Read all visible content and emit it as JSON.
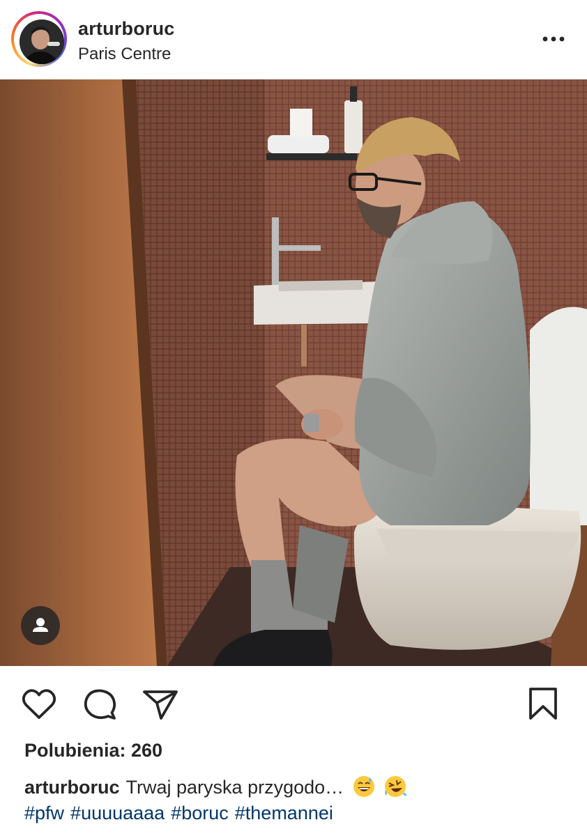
{
  "post": {
    "username": "arturboruc",
    "location": "Paris Centre",
    "likes_text": "Polubienia: 260",
    "caption": {
      "username": "arturboruc",
      "text": "Trwaj paryska przygodo…",
      "emojis": [
        "grinning-sweat-emoji",
        "rofl-emoji"
      ]
    },
    "hashtags": [
      "#pfw",
      "#uuuuaaaa",
      "#boruc",
      "#themannei"
    ]
  },
  "icons": {
    "more": "more-dots-icon",
    "tag": "user-tag-icon",
    "like": "heart-icon",
    "comment": "comment-icon",
    "share": "paper-plane-icon",
    "save": "bookmark-icon"
  },
  "colors": {
    "text": "#262626",
    "hashtag": "#00376b",
    "story_ring": [
      "#feda75",
      "#fa7e1e",
      "#d62976",
      "#962fbf",
      "#4f5bd5"
    ]
  }
}
